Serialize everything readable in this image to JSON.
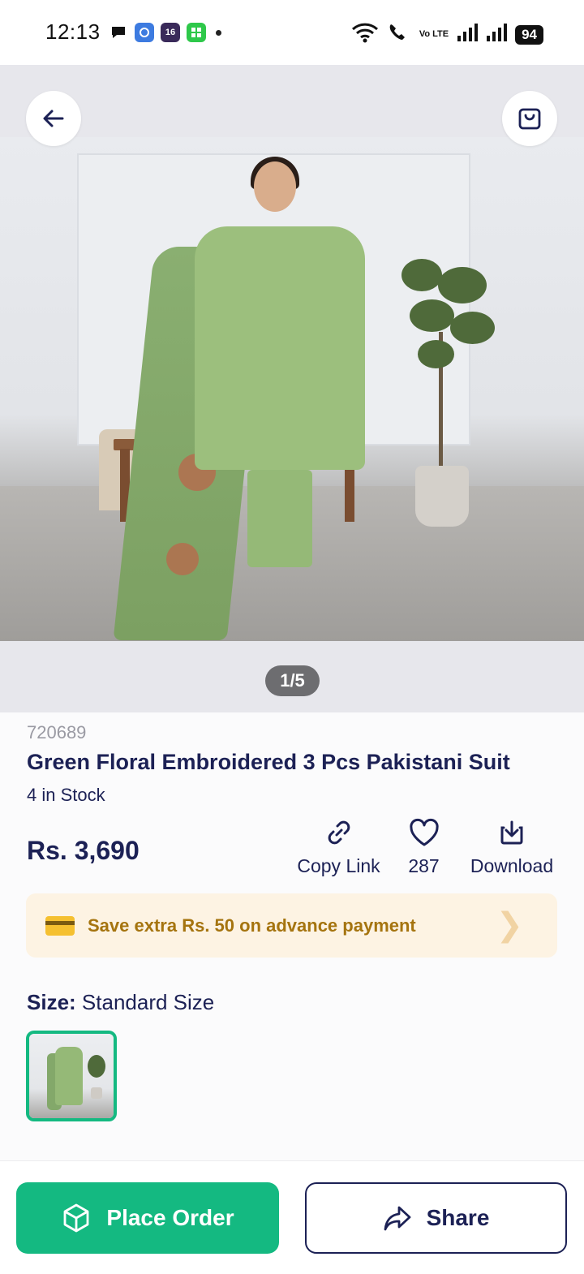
{
  "status_bar": {
    "time": "12:13",
    "notif_badge": "16",
    "network_label": "Vo LTE",
    "battery": "94"
  },
  "gallery": {
    "counter": "1/5"
  },
  "product": {
    "sku": "720689",
    "title": "Green Floral Embroidered 3 Pcs Pakistani Suit",
    "stock": "4 in Stock",
    "price": "Rs. 3,690"
  },
  "actions": {
    "copy_link": "Copy Link",
    "likes": "287",
    "download": "Download"
  },
  "promo": {
    "text": "Save extra Rs. 50 on advance payment"
  },
  "size": {
    "label": "Size:",
    "value": "Standard Size"
  },
  "bottom": {
    "place_order": "Place Order",
    "share": "Share"
  },
  "colors": {
    "primary_navy": "#1c2155",
    "accent_green": "#14b981",
    "promo_bg": "#fdf3e3",
    "promo_text": "#a5740f"
  }
}
